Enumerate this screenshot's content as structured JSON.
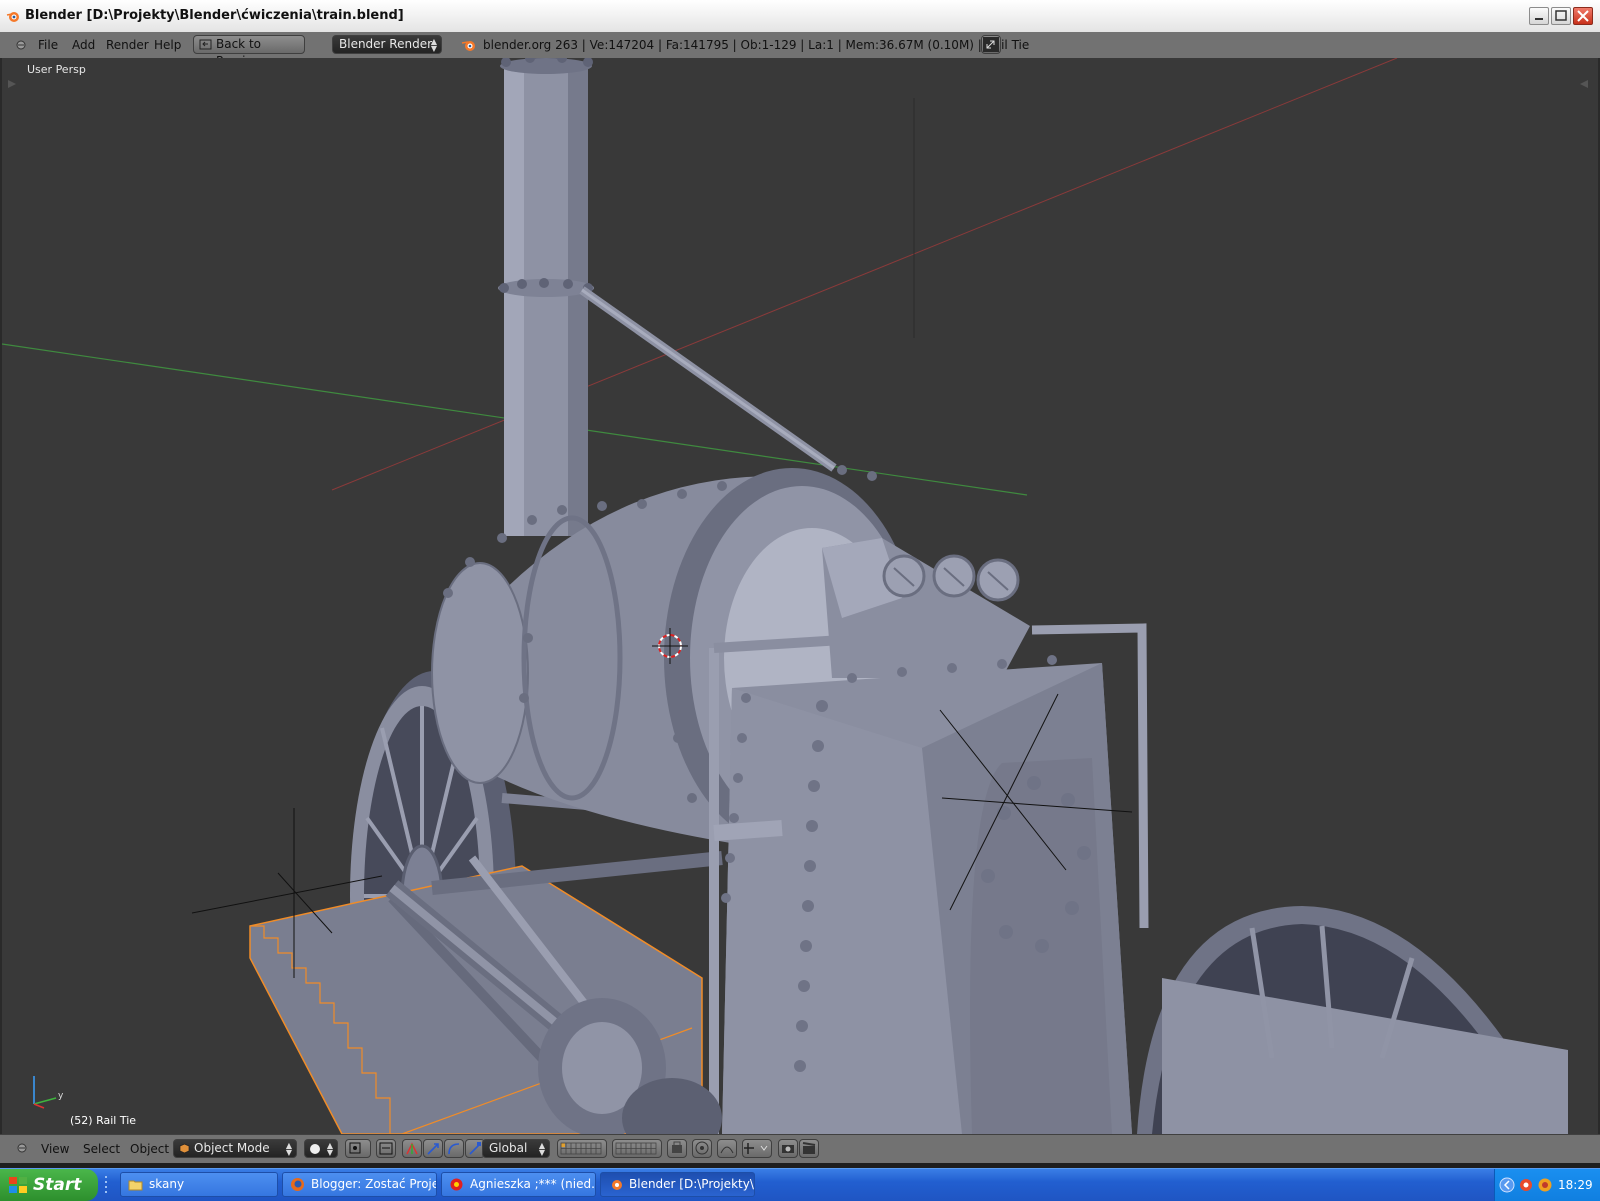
{
  "window": {
    "title": "Blender [D:\\Projekty\\Blender\\ćwiczenia\\train.blend]"
  },
  "info_header": {
    "menus": [
      "File",
      "Add",
      "Render",
      "Help"
    ],
    "back_button": "Back to Previous",
    "render_engine": "Blender Render",
    "stats": "blender.org 263 | Ve:147204 | Fa:141795 | Ob:1-129 | La:1 | Mem:36.67M (0.10M) | Rail Tie"
  },
  "viewport": {
    "view_label": "User Persp",
    "object_label": "(52) Rail Tie",
    "axis_x_color": "#8a3a3a",
    "axis_y_color": "#3f8a3f",
    "mesh_color": "#8f93a6",
    "selection_color": "#f08c28"
  },
  "view_header": {
    "menus": [
      "View",
      "Select",
      "Object"
    ],
    "mode": "Object Mode",
    "orientation": "Global"
  },
  "taskbar": {
    "start_label": "Start",
    "tasks": [
      "skany",
      "Blogger: Zostać Proje...",
      "Agnieszka ;*** (nied...",
      "Blender [D:\\Projekty\\..."
    ],
    "clock": "18:29"
  }
}
